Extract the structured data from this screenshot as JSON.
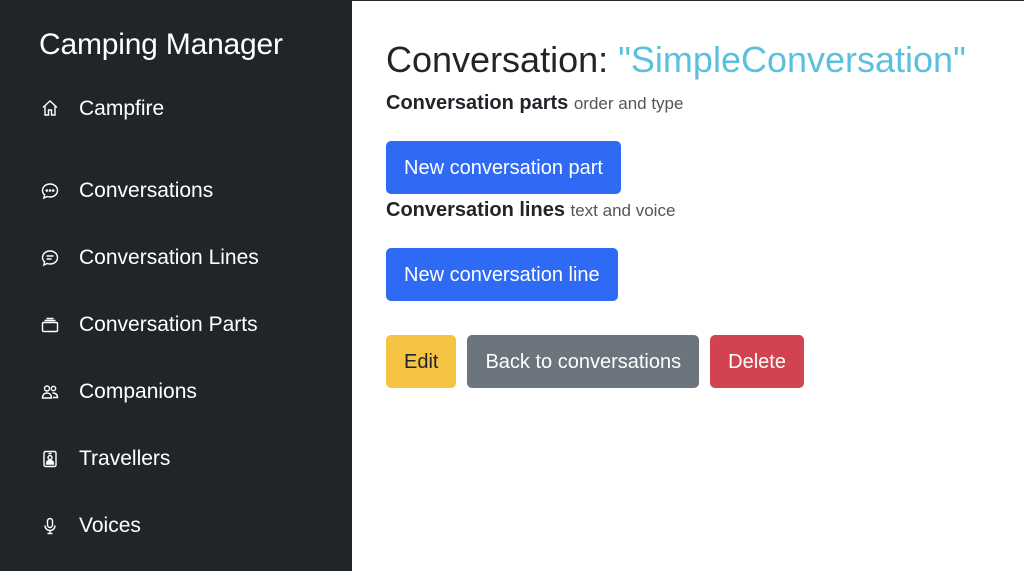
{
  "sidebar": {
    "brand": "Camping Manager",
    "items": [
      {
        "label": "Campfire",
        "icon": "house-icon"
      },
      {
        "label": "Conversations",
        "icon": "chat-dots-icon"
      },
      {
        "label": "Conversation Lines",
        "icon": "chat-lines-icon"
      },
      {
        "label": "Conversation Parts",
        "icon": "stack-icon"
      },
      {
        "label": "Companions",
        "icon": "people-icon"
      },
      {
        "label": "Travellers",
        "icon": "person-badge-icon"
      },
      {
        "label": "Voices",
        "icon": "microphone-icon"
      }
    ]
  },
  "main": {
    "title_prefix": "Conversation:",
    "title_name": "\"SimpleConversation\"",
    "parts_heading": "Conversation parts",
    "parts_sub": "order and type",
    "new_part_button": "New conversation part",
    "lines_heading": "Conversation lines",
    "lines_sub": "text and voice",
    "new_line_button": "New conversation line",
    "edit_button": "Edit",
    "back_button": "Back to conversations",
    "delete_button": "Delete"
  },
  "colors": {
    "sidebar_bg": "#212529",
    "primary": "#2f6af4",
    "warning": "#f6c343",
    "secondary": "#6c757d",
    "danger": "#d0434f",
    "title_accent": "#5bc0de"
  }
}
